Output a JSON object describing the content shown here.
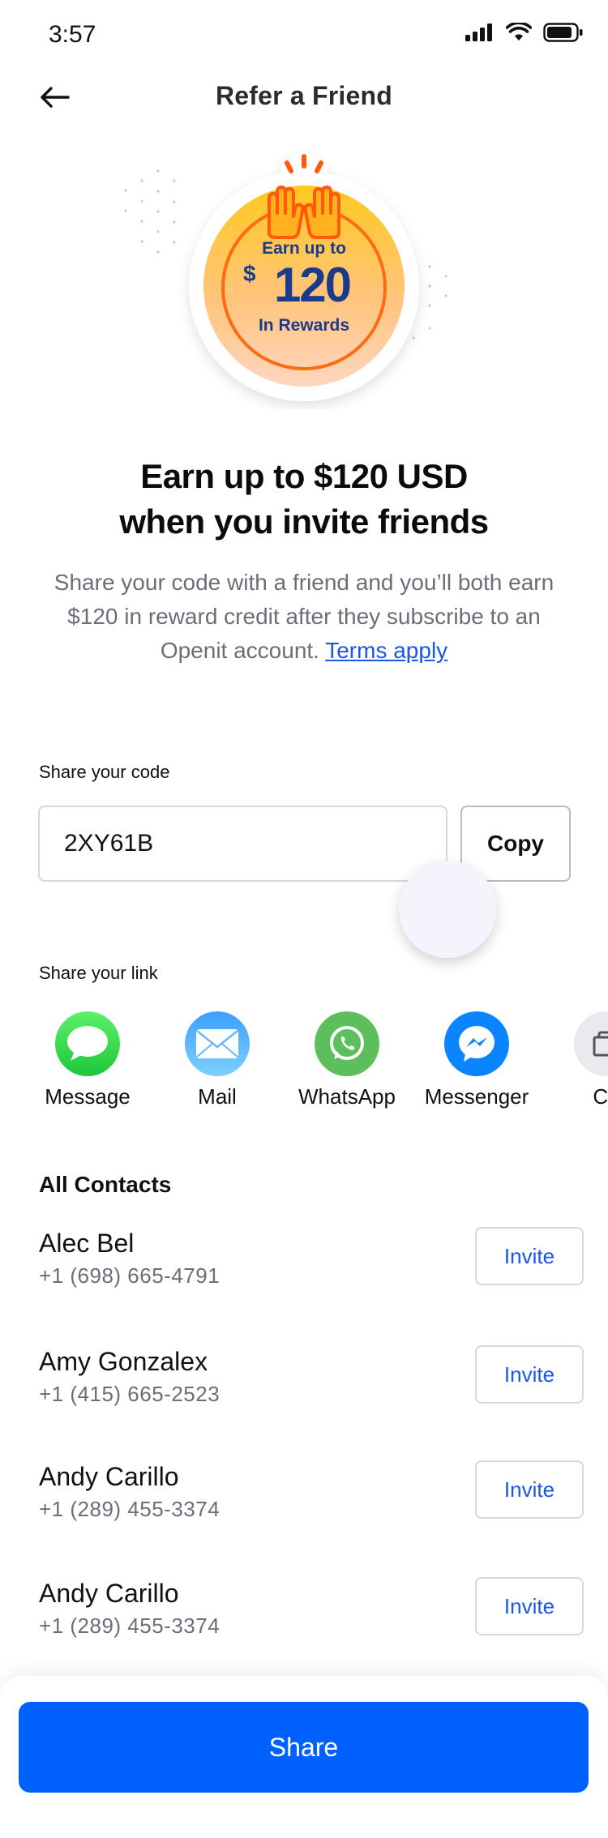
{
  "status_bar": {
    "time": "3:57"
  },
  "nav": {
    "title": "Refer a Friend"
  },
  "hero": {
    "line1": "Earn up to",
    "currency": "$",
    "amount": "120",
    "line3": "In Rewards"
  },
  "headline": {
    "line1": "Earn up to $120 USD",
    "line2": "when you invite friends"
  },
  "description": {
    "text": "Share your code with a friend and you’ll both earn $120 in reward credit after they subscribe to an Openit account.",
    "terms_link": "Terms apply"
  },
  "share_code": {
    "label": "Share your code",
    "code": "2XY61B",
    "copy_label": "Copy"
  },
  "share_link": {
    "label": "Share your link",
    "apps": [
      {
        "label": "Message",
        "icon": "message-icon"
      },
      {
        "label": "Mail",
        "icon": "mail-icon"
      },
      {
        "label": "WhatsApp",
        "icon": "whatsapp-icon"
      },
      {
        "label": "Messenger",
        "icon": "messenger-icon"
      },
      {
        "label": "Co",
        "icon": "copy-icon"
      }
    ]
  },
  "contacts": {
    "title": "All Contacts",
    "items": [
      {
        "name": "Alec Bel",
        "phone": "+1 (698) 665-4791",
        "action": "Invite"
      },
      {
        "name": "Amy Gonzalex",
        "phone": "+1 (415) 665-2523",
        "action": "Invite"
      },
      {
        "name": "Andy Carillo",
        "phone": "+1 (289) 455-3374",
        "action": "Invite"
      },
      {
        "name": "Andy Carillo",
        "phone": "+1 (289) 455-3374",
        "action": "Invite"
      }
    ]
  },
  "footer": {
    "share_label": "Share"
  },
  "colors": {
    "primary": "#0061ff",
    "link": "#1a56e8",
    "hero_orange": "#ff6a13",
    "hero_navy": "#1b3a8c"
  }
}
